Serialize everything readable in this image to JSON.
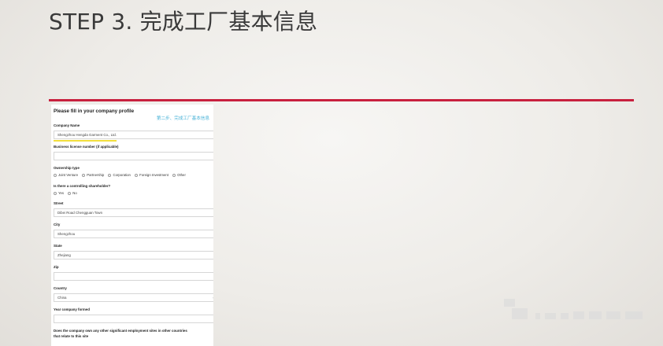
{
  "slide": {
    "title": "STEP 3. 完成工厂基本信息"
  },
  "form": {
    "heading": "Please fill in your company profile",
    "annotation": "第二步、完成工厂基本信息",
    "company_name": {
      "label": "Company Name",
      "value": "Shengzhou Hengda Garment Co., Ltd."
    },
    "business_license": {
      "label": "Business license number (if applicable)",
      "value": ""
    },
    "ownership": {
      "label": "Ownership type",
      "options": [
        "Joint Venture",
        "Partnership",
        "Corporation",
        "Foreign Investment",
        "Other"
      ]
    },
    "controlling": {
      "label": "Is there a controlling shareholder?",
      "options": [
        "Yes",
        "No"
      ]
    },
    "street": {
      "label": "Street",
      "value": "Dibei Road Chengguan Town"
    },
    "city": {
      "label": "City",
      "value": "Shengzhou"
    },
    "state": {
      "label": "State",
      "value": "Zhejiang"
    },
    "zip": {
      "label": "Zip",
      "value": ""
    },
    "country": {
      "label": "Country",
      "value": "China"
    },
    "year_formed": {
      "label": "Year company formed",
      "value": ""
    },
    "other_sites": {
      "label_line1": "Does the company own any other significant employment sites in other countries",
      "label_line2": "that relate to this site"
    }
  },
  "colors": {
    "accent_line": "#c8203e",
    "annotation": "#4ab3d8",
    "highlight": "#f2de3c"
  }
}
